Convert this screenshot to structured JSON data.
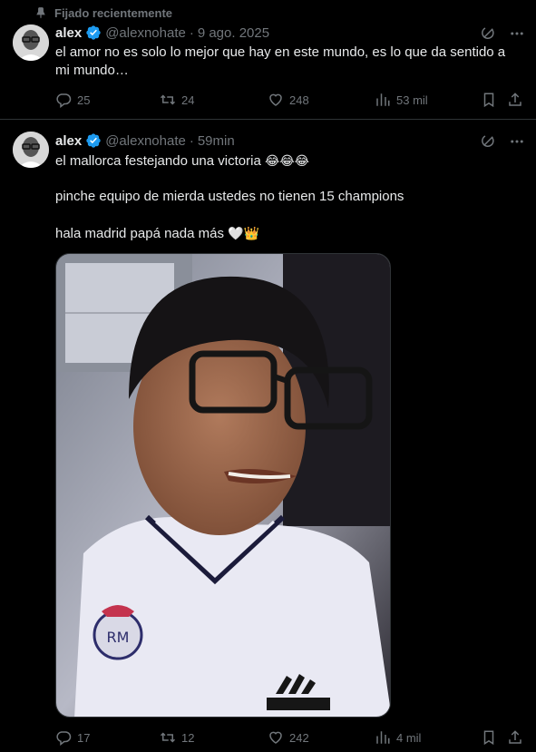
{
  "pinned": {
    "label": "Fijado recientemente"
  },
  "tweets": [
    {
      "name": "alex",
      "handle": "@alexnohate",
      "time": "9 ago. 2025",
      "text": "el amor no es solo lo mejor que hay en este mundo, es lo que da sentido a mi mundo…",
      "replies": "25",
      "retweets": "24",
      "likes": "248",
      "views": "53 mil"
    },
    {
      "name": "alex",
      "handle": "@alexnohate",
      "time": "59min",
      "line1": "el mallorca festejando una victoria",
      "line1_emoji": "😂😂😂",
      "line2": "pinche equipo de mierda ustedes no tienen 15 champions",
      "line3": "hala madrid papá nada más",
      "line3_emoji": "🤍👑",
      "replies": "17",
      "retweets": "12",
      "likes": "242",
      "views": "4 mil"
    }
  ],
  "separator": "·",
  "icons": [
    "pin-icon",
    "verified-badge-icon",
    "grok-icon",
    "more-icon",
    "reply-icon",
    "retweet-icon",
    "like-icon",
    "views-icon",
    "bookmark-icon",
    "share-icon"
  ]
}
